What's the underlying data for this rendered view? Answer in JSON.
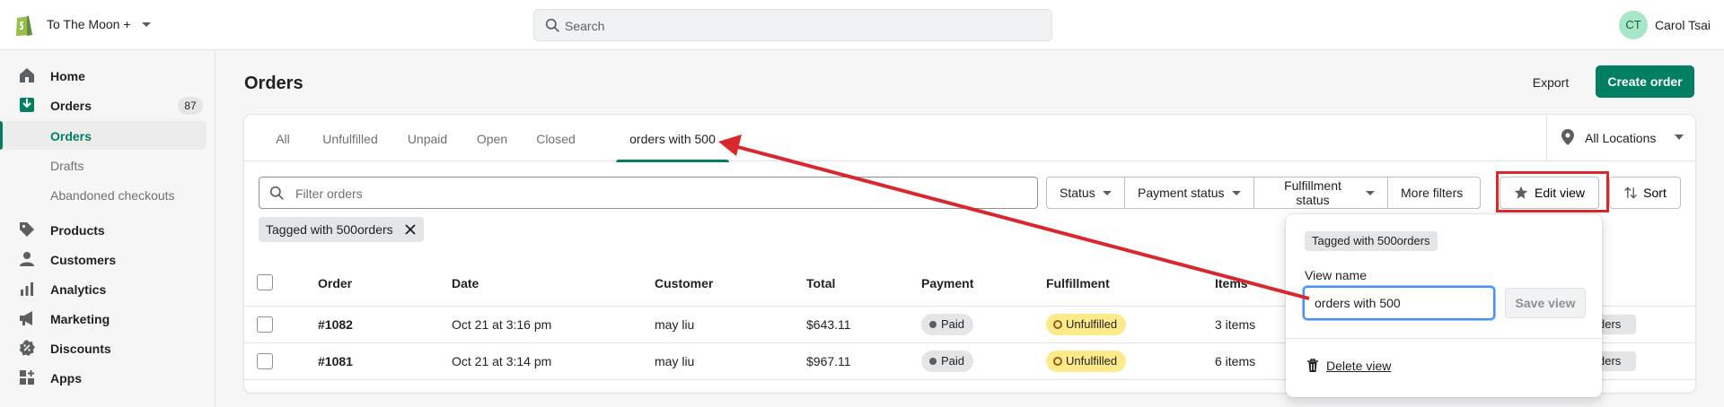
{
  "header": {
    "store_name": "To The Moon +",
    "search_placeholder": "Search",
    "user_initials": "CT",
    "user_name": "Carol Tsai"
  },
  "sidebar": {
    "home": "Home",
    "orders": "Orders",
    "orders_count": "87",
    "orders_sub": "Orders",
    "drafts": "Drafts",
    "abandoned": "Abandoned checkouts",
    "products": "Products",
    "customers": "Customers",
    "analytics": "Analytics",
    "marketing": "Marketing",
    "discounts": "Discounts",
    "apps": "Apps"
  },
  "page": {
    "title": "Orders",
    "export_label": "Export",
    "create_label": "Create order"
  },
  "tabs": [
    "All",
    "Unfulfilled",
    "Unpaid",
    "Open",
    "Closed",
    "orders with 500"
  ],
  "locations_label": "All Locations",
  "filters": {
    "placeholder": "Filter orders",
    "status": "Status",
    "payment_status": "Payment status",
    "fulfillment_status": "Fulfillment status",
    "more_filters": "More filters",
    "edit_view": "Edit view",
    "sort": "Sort",
    "applied_tag": "Tagged with 500orders"
  },
  "table": {
    "columns": [
      "Order",
      "Date",
      "Customer",
      "Total",
      "Payment",
      "Fulfillment",
      "Items"
    ],
    "rows": [
      {
        "order": "#1082",
        "date": "Oct 21 at 3:16 pm",
        "customer": "may liu",
        "total": "$643.11",
        "payment": "Paid",
        "fulfillment": "Unfulfilled",
        "items": "3 items",
        "tag": "ders"
      },
      {
        "order": "#1081",
        "date": "Oct 21 at 3:14 pm",
        "customer": "may liu",
        "total": "$967.11",
        "payment": "Paid",
        "fulfillment": "Unfulfilled",
        "items": "6 items",
        "tag": "ders"
      }
    ]
  },
  "popover": {
    "tag_chip": "Tagged with 500orders",
    "view_name_label": "View name",
    "view_name_value": "orders with 500",
    "save_label": "Save view",
    "delete_label": "Delete view"
  },
  "colors": {
    "brand_green": "#008060",
    "annotation_red": "#d9272e"
  }
}
